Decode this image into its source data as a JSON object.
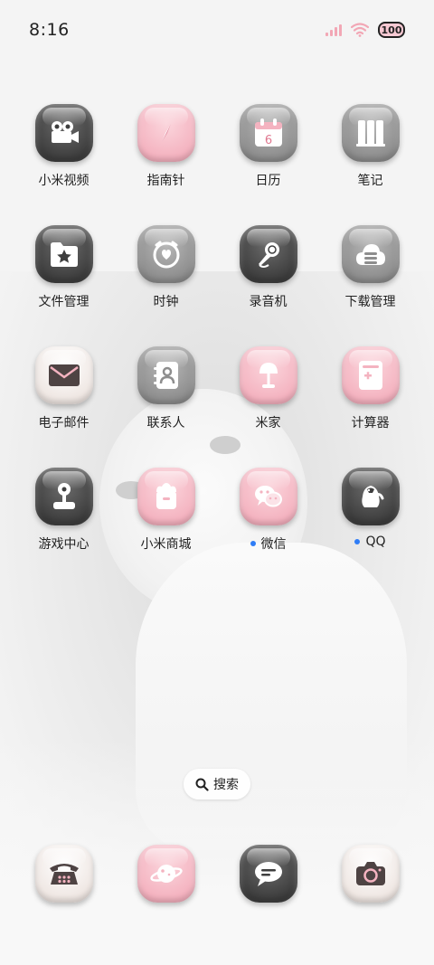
{
  "status_bar": {
    "time": "8:16",
    "battery": "100"
  },
  "apps": [
    {
      "label": "小米视频",
      "icon": "video-camera-icon",
      "badge": false
    },
    {
      "label": "指南针",
      "icon": "compass-icon",
      "badge": false
    },
    {
      "label": "日历",
      "icon": "calendar-icon",
      "calendar_day": "6",
      "badge": false
    },
    {
      "label": "笔记",
      "icon": "notes-icon",
      "badge": false
    },
    {
      "label": "文件管理",
      "icon": "folder-star-icon",
      "badge": false
    },
    {
      "label": "时钟",
      "icon": "alarm-clock-icon",
      "badge": false
    },
    {
      "label": "录音机",
      "icon": "microphone-icon",
      "badge": false
    },
    {
      "label": "下载管理",
      "icon": "cloud-download-icon",
      "badge": false
    },
    {
      "label": "电子邮件",
      "icon": "mail-icon",
      "badge": false
    },
    {
      "label": "联系人",
      "icon": "contacts-book-icon",
      "badge": false
    },
    {
      "label": "米家",
      "icon": "lamp-icon",
      "badge": false
    },
    {
      "label": "计算器",
      "icon": "calculator-icon",
      "badge": false
    },
    {
      "label": "游戏中心",
      "icon": "joystick-icon",
      "badge": false
    },
    {
      "label": "小米商城",
      "icon": "shopping-bag-icon",
      "badge": false
    },
    {
      "label": "微信",
      "icon": "wechat-icon",
      "badge": true
    },
    {
      "label": "QQ",
      "icon": "penguin-icon",
      "badge": true
    }
  ],
  "search": {
    "label": "搜索"
  },
  "dock": [
    {
      "icon": "telephone-icon"
    },
    {
      "icon": "planet-browser-icon"
    },
    {
      "icon": "message-bubble-icon"
    },
    {
      "icon": "camera-icon"
    }
  ],
  "colors": {
    "pink": "#f4b3c0",
    "dark": "#3e3e3e",
    "gray": "#8e8e8e",
    "badge_blue": "#2f7df6"
  }
}
